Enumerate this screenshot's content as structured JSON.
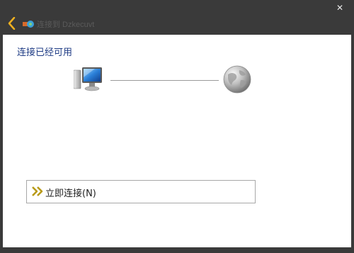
{
  "window": {
    "title": "连接到 Dzkecuvt",
    "close_label": "✕"
  },
  "content": {
    "heading": "连接已经可用",
    "connect_button_label": "立即连接(N)"
  },
  "colors": {
    "frame": "#3a3a3a",
    "heading_text": "#1e3b84",
    "back_arrow": "#f0b020",
    "connect_arrow": "#b89a18"
  },
  "icons": {
    "back": "back-arrow-icon",
    "network": "network-icon",
    "computer": "computer-icon",
    "globe": "globe-icon",
    "connect": "double-chevron-icon"
  }
}
